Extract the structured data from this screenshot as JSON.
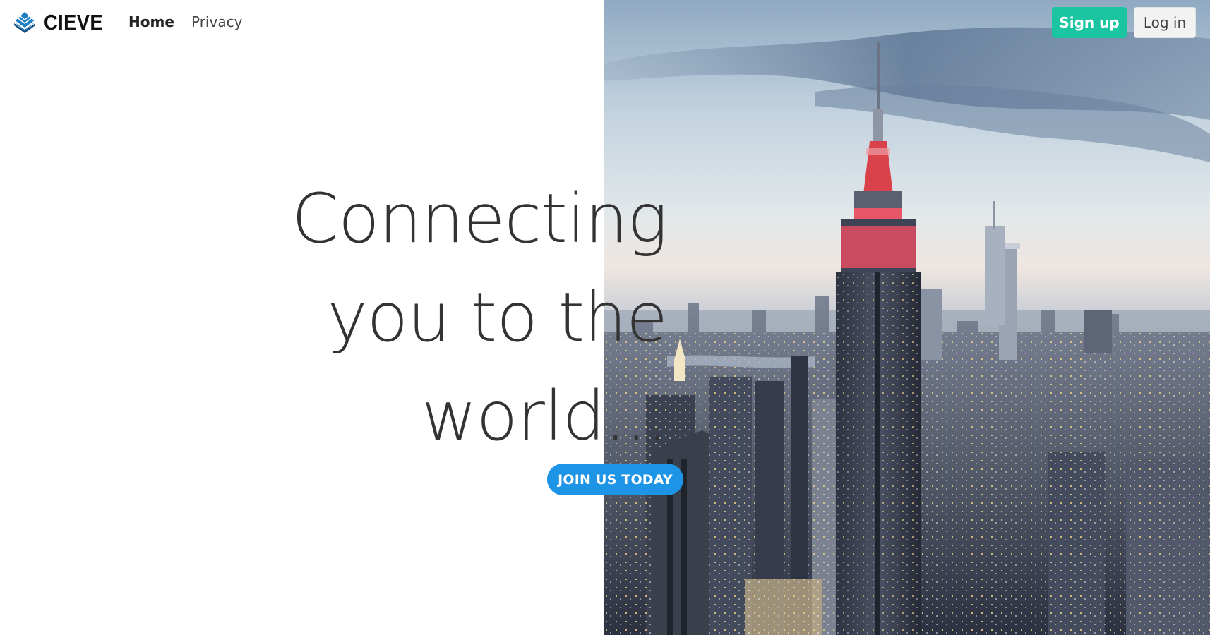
{
  "brand": {
    "name": "CIEVE",
    "logo_icon": "layered-pyramid-icon"
  },
  "nav": {
    "home_label": "Home",
    "privacy_label": "Privacy"
  },
  "auth": {
    "signup_label": "Sign up",
    "login_label": "Log in"
  },
  "hero": {
    "headline_lines": [
      "Connecting",
      "you to the",
      "world..."
    ],
    "cta_label": "JOIN US TODAY",
    "image_subject": "city-skyline-photo"
  },
  "colors": {
    "signup": "#1bc5a2",
    "cta": "#1e94e6",
    "headline": "#333333",
    "logo_blue": "#1c7fc4"
  }
}
